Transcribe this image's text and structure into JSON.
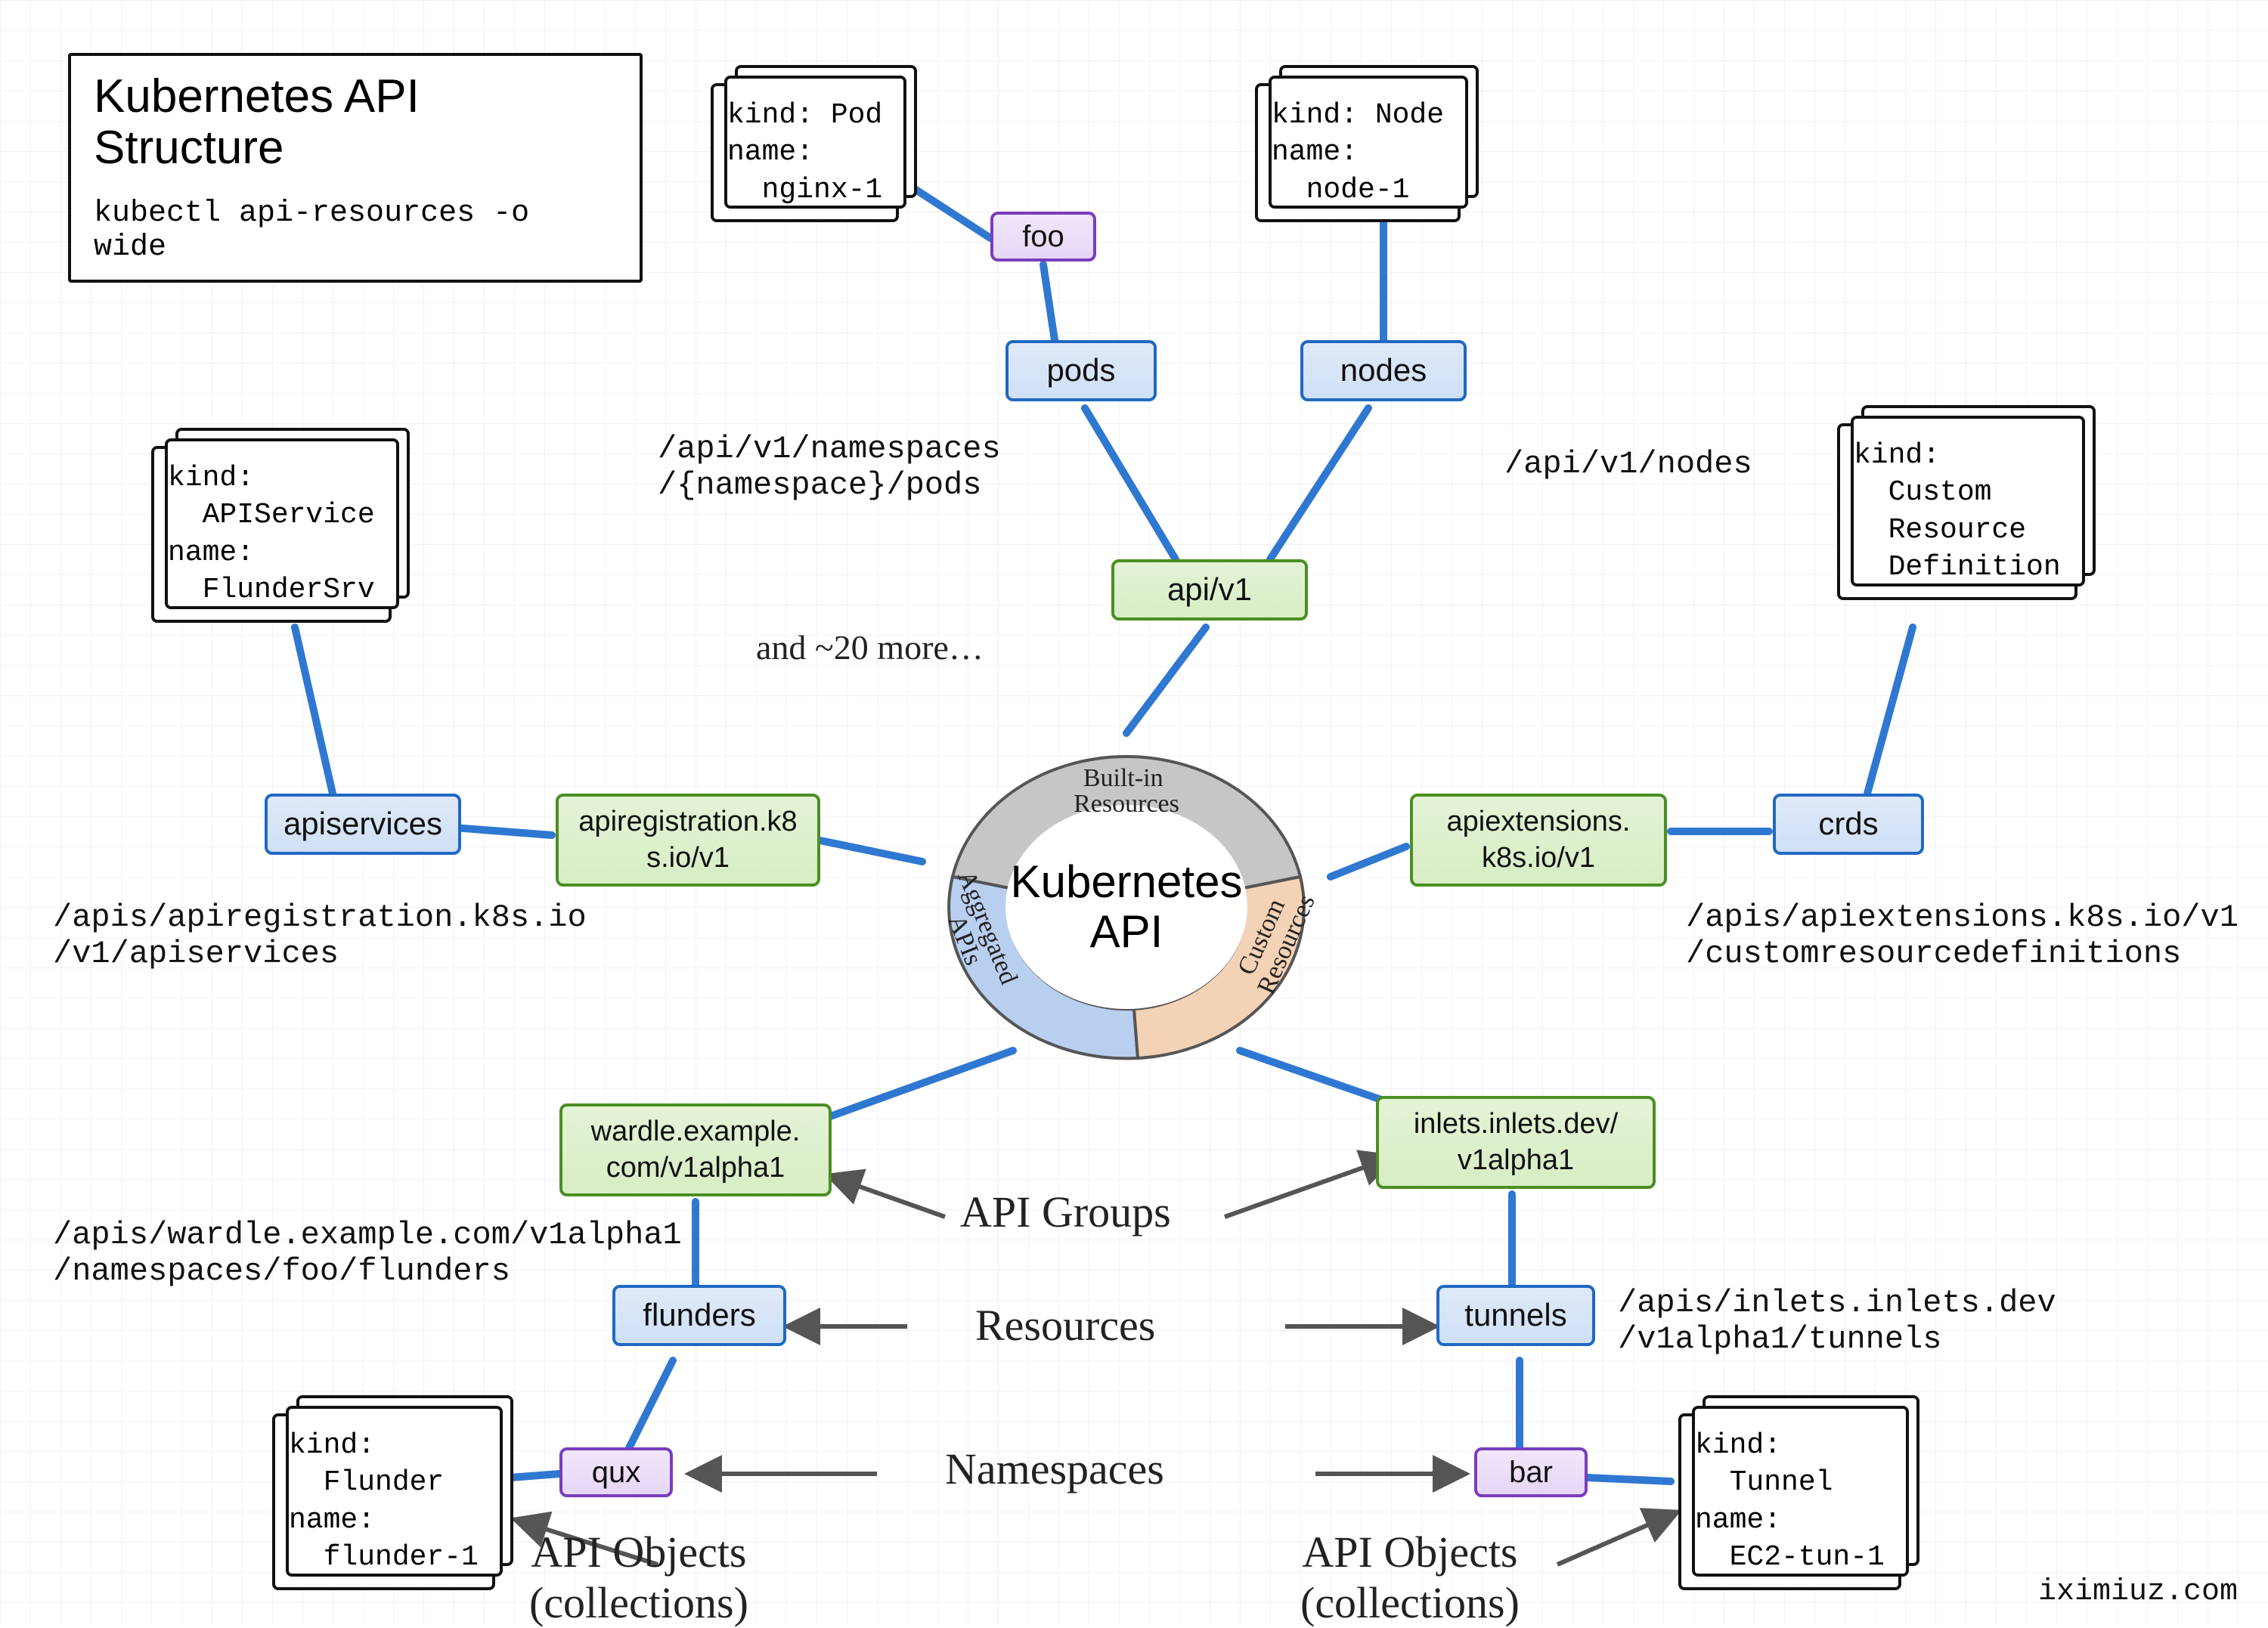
{
  "title": {
    "heading": "Kubernetes API\nStructure",
    "command": "kubectl api-resources -o wide"
  },
  "center": {
    "label": "Kubernetes\nAPI",
    "seg_builtin": "Built-in\nResources",
    "seg_aggregated": "Aggregated\nAPIs",
    "seg_custom": "Custom\nResources"
  },
  "groups": {
    "core": "api/v1",
    "apiregistration": "apiregistration.k8\ns.io/v1",
    "apiextensions": "apiextensions.\nk8s.io/v1",
    "wardle": "wardle.example.\ncom/v1alpha1",
    "inlets": "inlets.inlets.dev/\nv1alpha1"
  },
  "resources": {
    "pods": "pods",
    "nodes": "nodes",
    "apiservices": "apiservices",
    "crds": "crds",
    "flunders": "flunders",
    "tunnels": "tunnels"
  },
  "namespaces": {
    "foo": "foo",
    "qux": "qux",
    "bar": "bar"
  },
  "objects": {
    "pod": "kind: Pod\nname:\n  nginx-1",
    "node": "kind: Node\nname:\n  node-1",
    "apiservice": "kind:\n  APIService\nname:\n  FlunderSrv",
    "crd": "kind:\n  Custom\n  Resource\n  Definition",
    "flunder": "kind:\n  Flunder\nname:\n  flunder-1",
    "tunnel": "kind:\n  Tunnel\nname:\n  EC2-tun-1"
  },
  "paths": {
    "pods": "/api/v1/namespaces\n/{namespace}/pods",
    "nodes": "/api/v1/nodes",
    "apiservices": "/apis/apiregistration.k8s.io\n/v1/apiservices",
    "crds": "/apis/apiextensions.k8s.io/v1\n/customresourcedefinitions",
    "wardle": "/apis/wardle.example.com/v1alpha1\n/namespaces/foo/flunders",
    "inlets": "/apis/inlets.inlets.dev\n/v1alpha1/tunnels"
  },
  "annotations": {
    "api_groups": "API Groups",
    "resources": "Resources",
    "namespaces": "Namespaces",
    "api_objects_l": "API Objects\n(collections)",
    "api_objects_r": "API Objects\n(collections)",
    "more": "and ~20 more…"
  },
  "attribution": "iximiuz.com"
}
